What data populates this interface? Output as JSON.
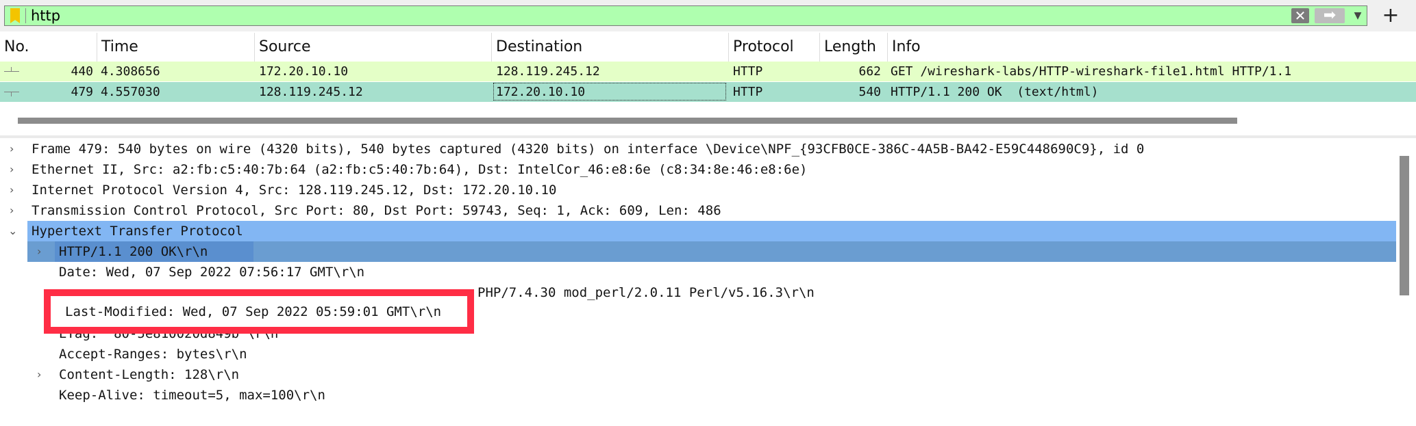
{
  "filter": {
    "value": "http",
    "clear_label": "✕",
    "apply_label": "➡",
    "dropdown_label": "▼",
    "add_label": "+"
  },
  "columns": {
    "no": "No.",
    "time": "Time",
    "source": "Source",
    "destination": "Destination",
    "protocol": "Protocol",
    "length": "Length",
    "info": "Info"
  },
  "packets": [
    {
      "no": "440",
      "time": "4.308656",
      "source": "172.20.10.10",
      "destination": "128.119.245.12",
      "protocol": "HTTP",
      "length": "662",
      "info": "GET /wireshark-labs/HTTP-wireshark-file1.html HTTP/1.1"
    },
    {
      "no": "479",
      "time": "4.557030",
      "source": "128.119.245.12",
      "destination": "172.20.10.10",
      "protocol": "HTTP",
      "length": "540",
      "info": "HTTP/1.1 200 OK  (text/html)"
    }
  ],
  "details": {
    "frame": "Frame 479: 540 bytes on wire (4320 bits), 540 bytes captured (4320 bits) on interface \\Device\\NPF_{93CFB0CE-386C-4A5B-BA42-E59C448690C9}, id 0",
    "ethernet": "Ethernet II, Src: a2:fb:c5:40:7b:64 (a2:fb:c5:40:7b:64), Dst: IntelCor_46:e8:6e (c8:34:8e:46:e8:6e)",
    "ip": "Internet Protocol Version 4, Src: 128.119.245.12, Dst: 172.20.10.10",
    "tcp": "Transmission Control Protocol, Src Port: 80, Dst Port: 59743, Seq: 1, Ack: 609, Len: 486",
    "http": "Hypertext Transfer Protocol",
    "status": "HTTP/1.1 200 OK\\r\\n",
    "date": "Date: Wed, 07 Sep 2022 07:56:17 GMT\\r\\n",
    "server_tail": "PHP/7.4.30 mod_perl/2.0.11 Perl/v5.16.3\\r\\n",
    "last_modified": "Last-Modified: Wed, 07 Sep 2022 05:59:01 GMT\\r\\n",
    "etag_partial": "ETag: \"80-5e810020d849b\"\\r\\n",
    "accept_ranges": "Accept-Ranges: bytes\\r\\n",
    "content_length": "Content-Length: 128\\r\\n",
    "keep_alive": "Keep-Alive: timeout=5, max=100\\r\\n"
  },
  "tree_glyphs": {
    "collapsed": "›",
    "expanded": "⌄"
  },
  "colors": {
    "filter_valid": "#afffaf",
    "row_http": "#e4ffc7",
    "row_selected": "#a6e0cd",
    "detail_selected": "#82b6f3",
    "annotation": "#ff2d45"
  }
}
